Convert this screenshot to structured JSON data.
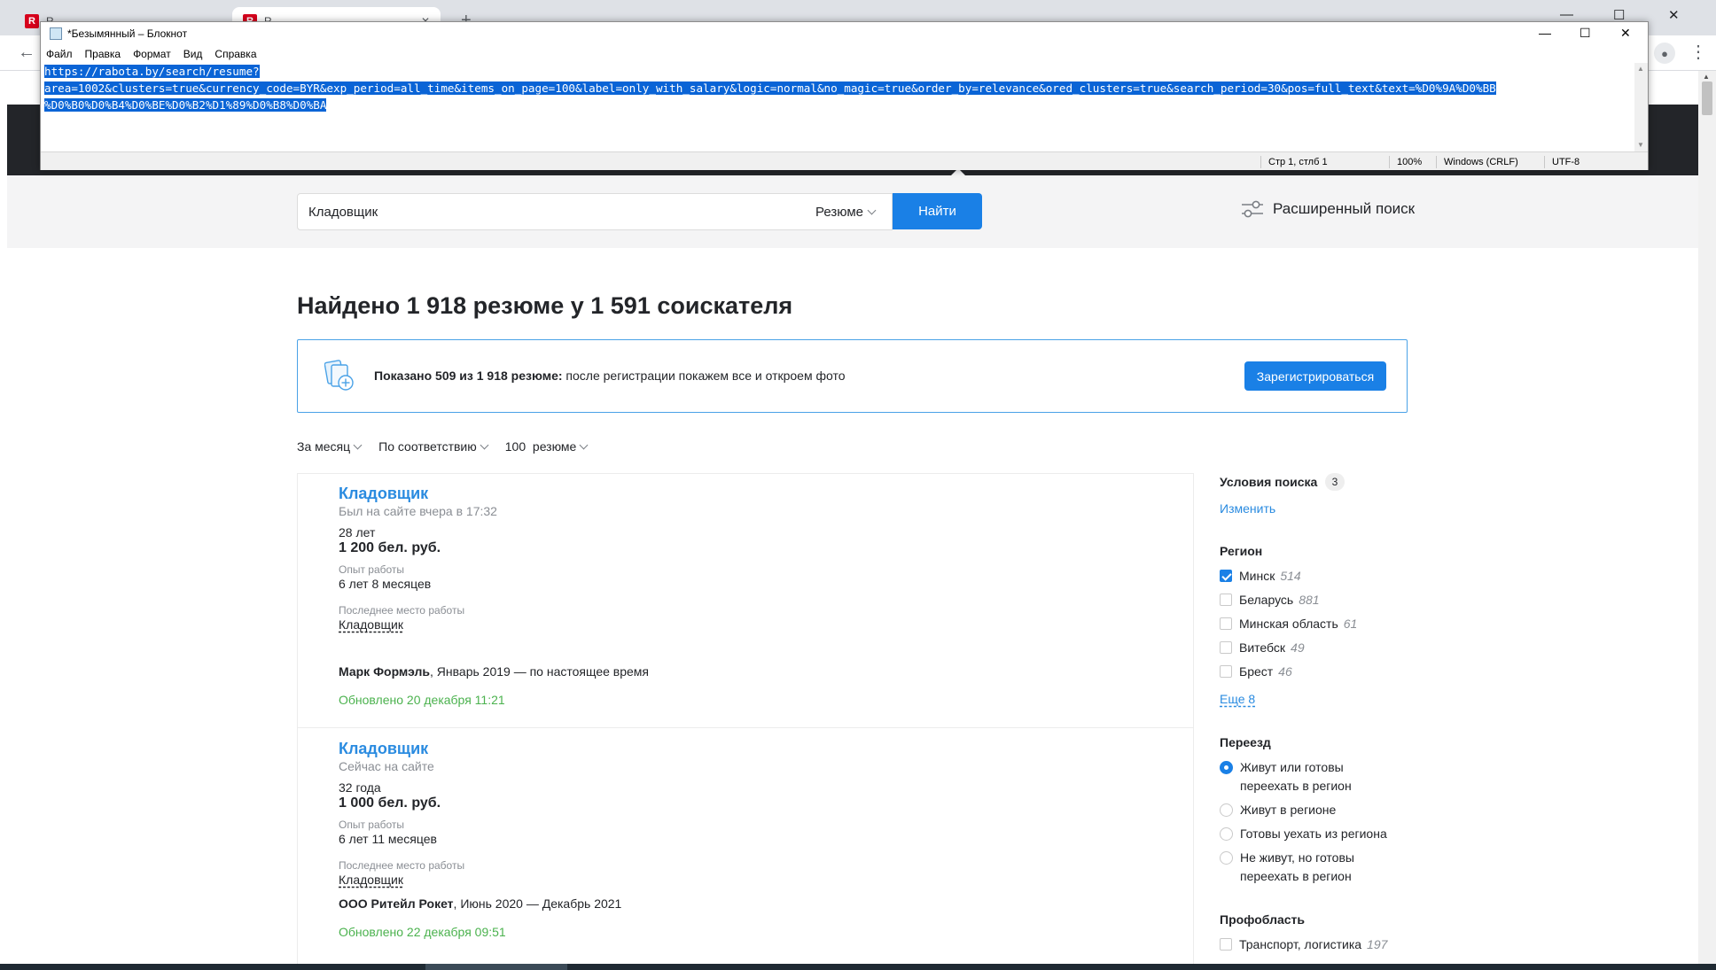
{
  "browser": {
    "tabs": [
      {
        "label": "R...",
        "favicon": "R",
        "active": false
      },
      {
        "label": "R...",
        "favicon": "R",
        "active": true
      }
    ],
    "controls": {
      "minimize": "—",
      "maximize": "☐",
      "close": "✕"
    },
    "profile_icon": "person-icon",
    "menu_icon": "⋮"
  },
  "notepad": {
    "title": "*Безымянный – Блокнот",
    "menu": [
      "Файл",
      "Правка",
      "Формат",
      "Вид",
      "Справка"
    ],
    "controls": {
      "minimize": "—",
      "maximize": "☐",
      "close": "✕"
    },
    "lines": [
      "https://rabota.by/search/resume?",
      "area=1002&clusters=true&currency_code=BYR&exp_period=all_time&items_on_page=100&label=only_with_salary&logic=normal&no_magic=true&order_by=relevance&ored_clusters=true&search_period=30&pos=full_text&text=%D0%9A%D0%BB",
      "%D0%B0%D0%B4%D0%BE%D0%B2%D1%89%D0%B8%D0%BA"
    ],
    "status": {
      "position": "Стр 1, стлб 1",
      "zoom": "100%",
      "line_ending": "Windows (CRLF)",
      "encoding": "UTF-8"
    }
  },
  "search": {
    "query": "Кладовщик",
    "type": "Резюме",
    "button": "Найти",
    "advanced": "Расширенный поиск"
  },
  "results_title": "Найдено 1 918 резюме у 1 591 соискателя",
  "promo": {
    "bold": "Показано 509 из 1 918 резюме:",
    "text": " после регистрации покажем все и откроем фото",
    "button": "Зарегистрироваться"
  },
  "filters": [
    "За месяц",
    "По соответствию",
    "100  резюме"
  ],
  "resumes": [
    {
      "title": "Кладовщик",
      "seen": "Был на сайте вчера в 17:32",
      "age": "28 лет",
      "salary": "1 200 бел. руб.",
      "exp_label": "Опыт работы",
      "exp": "6 лет 8 месяцев",
      "last_label": "Последнее место работы",
      "last_position": "Кладовщик",
      "employer": "Марк Формэль",
      "period": ", Январь 2019 — по настоящее время",
      "updated": "Обновлено 20 декабря 11:21"
    },
    {
      "title": "Кладовщик",
      "seen": "Сейчас на сайте",
      "age": "32 года",
      "salary": "1 000 бел. руб.",
      "exp_label": "Опыт работы",
      "exp": "6 лет 11 месяцев",
      "last_label": "Последнее место работы",
      "last_position": "Кладовщик",
      "employer": "ООО Ритейл Рокет",
      "period": ", Июнь 2020 — Декабрь 2021",
      "updated": "Обновлено 22 декабря 09:51"
    }
  ],
  "sidebar": {
    "conditions": {
      "title": "Условия поиска",
      "count": "3",
      "edit": "Изменить"
    },
    "region": {
      "title": "Регион",
      "options": [
        {
          "label": "Минск",
          "count": "514",
          "checked": true
        },
        {
          "label": "Беларусь",
          "count": "881",
          "checked": false
        },
        {
          "label": "Минская область",
          "count": "61",
          "checked": false
        },
        {
          "label": "Витебск",
          "count": "49",
          "checked": false
        },
        {
          "label": "Брест",
          "count": "46",
          "checked": false
        }
      ],
      "more": "Еще 8"
    },
    "relocation": {
      "title": "Переезд",
      "options": [
        {
          "label": "Живут или готовы переехать в регион",
          "checked": true
        },
        {
          "label": "Живут в регионе",
          "checked": false
        },
        {
          "label": "Готовы уехать из региона",
          "checked": false
        },
        {
          "label": "Не живут, но готовы переехать в регион",
          "checked": false
        }
      ]
    },
    "profarea": {
      "title": "Профобласть",
      "options": [
        {
          "label": "Транспорт, логистика",
          "count": "197",
          "checked": false
        }
      ]
    }
  }
}
